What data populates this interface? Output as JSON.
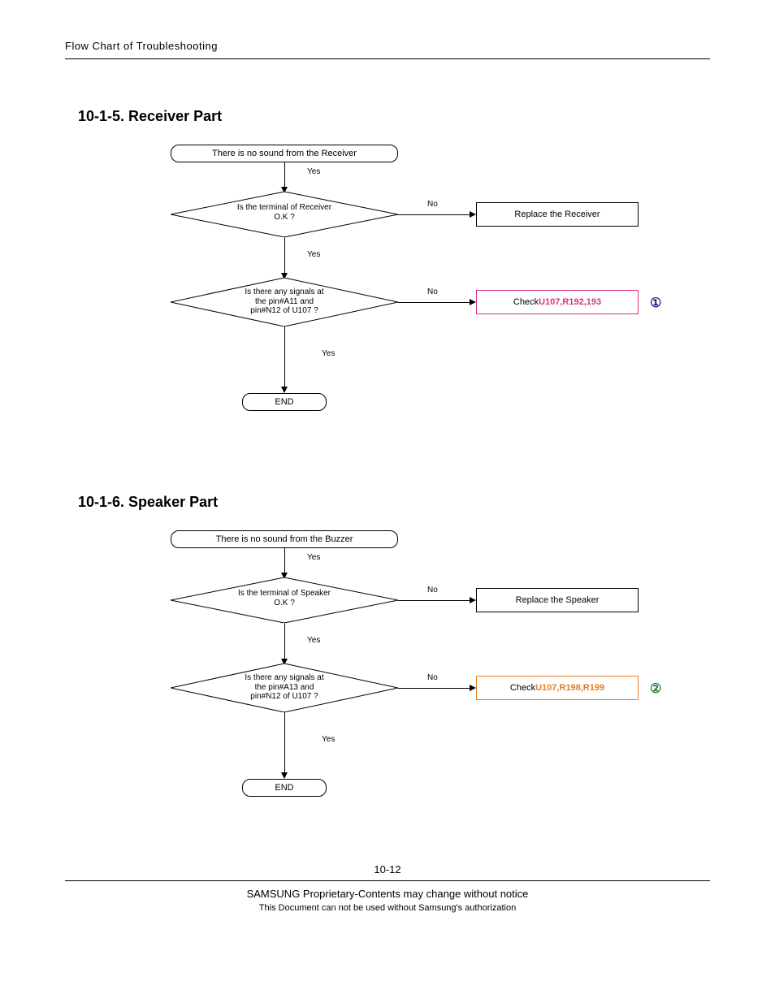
{
  "header": "Flow Chart of Troubleshooting",
  "section5": {
    "title": "10-1-5. Receiver Part",
    "start": "There is no sound from the Receiver",
    "dec1": "Is the terminal of Receiver\nO.K ?",
    "dec2": "Is there any signals at\nthe pin#A11 and\npin#N12 of U107 ?",
    "proc1": "Replace the Receiver",
    "proc2_pre": "Check ",
    "proc2_hl": "U107,R192,193",
    "badge": "①",
    "end": "END",
    "yes": "Yes",
    "no": "No"
  },
  "section6": {
    "title": "10-1-6. Speaker Part",
    "start": "There is no sound from the Buzzer",
    "dec1": "Is the terminal of Speaker\nO.K ?",
    "dec2": "Is there any signals at\nthe pin#A13 and\npin#N12 of U107 ?",
    "proc1": "Replace the Speaker",
    "proc2_pre": "Check ",
    "proc2_hl": "U107,R198,R199",
    "badge": "②",
    "end": "END",
    "yes": "Yes",
    "no": "No"
  },
  "pagenum": "10-12",
  "footer1": "SAMSUNG Proprietary-Contents may change without notice",
  "footer2": "This Document can not be used without Samsung's authorization"
}
